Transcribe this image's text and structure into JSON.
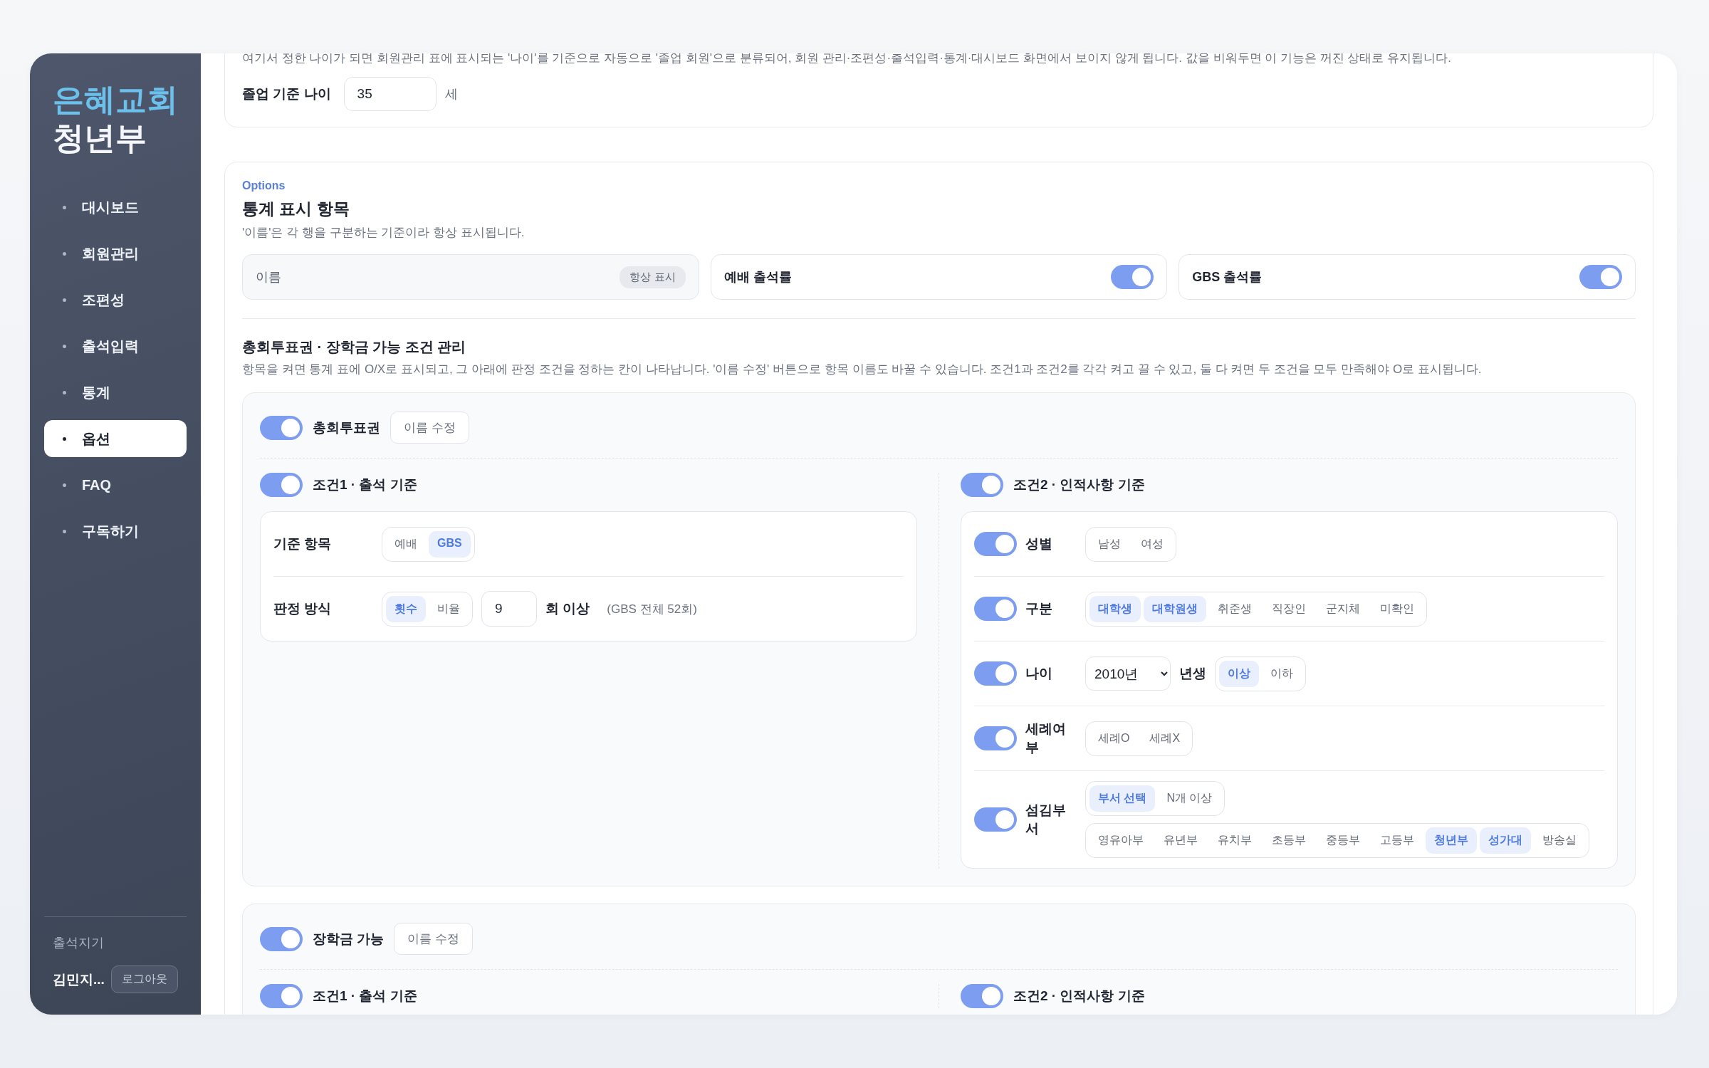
{
  "sidebar": {
    "logo_line1": "은혜교회",
    "logo_line2": "청년부",
    "items": [
      {
        "label": "대시보드",
        "selected": false
      },
      {
        "label": "회원관리",
        "selected": false
      },
      {
        "label": "조편성",
        "selected": false
      },
      {
        "label": "출석입력",
        "selected": false
      },
      {
        "label": "통계",
        "selected": false
      },
      {
        "label": "옵션",
        "selected": true
      },
      {
        "label": "FAQ",
        "selected": false
      },
      {
        "label": "구독하기",
        "selected": false
      }
    ],
    "footer_label": "출석지기",
    "user_name": "김민지...",
    "logout_button": "로그아웃"
  },
  "graduation": {
    "description": "여기서 정한 나이가 되면 회원관리 표에 표시되는 '나이'를 기준으로 자동으로 '졸업 회원'으로 분류되어, 회원 관리·조편성·출석입력·통계·대시보드 화면에서 보이지 않게 됩니다. 값을 비워두면 이 기능은 꺼진 상태로 유지됩니다.",
    "label": "졸업 기준 나이",
    "value": "35",
    "unit": "세"
  },
  "stats_options": {
    "eyebrow": "Options",
    "title": "통계 표시 항목",
    "description": "'이름'은 각 행을 구분하는 기준이라 항상 표시됩니다.",
    "items": [
      {
        "label": "이름",
        "kind": "fixed",
        "badge": "항상 표시"
      },
      {
        "label": "예배 출석률",
        "kind": "toggle",
        "on": true
      },
      {
        "label": "GBS 출석률",
        "kind": "toggle",
        "on": true
      }
    ]
  },
  "conditions": {
    "title": "총회투표권 · 장학금 가능 조건 관리",
    "description": "항목을 켜면 통계 표에 O/X로 표시되고, 그 아래에 판정 조건을 정하는 칸이 나타납니다. '이름 수정' 버튼으로 항목 이름도 바꿀 수 있습니다. 조건1과 조건2를 각각 켜고 끌 수 있고, 둘 다 켜면 두 조건을 모두 만족해야 O로 표시됩니다.",
    "panels": [
      {
        "name": "총회투표권",
        "on": true,
        "rename_button": "이름 수정",
        "condition1": {
          "title": "조건1 · 출석 기준",
          "on": true,
          "rows": [
            {
              "label": "기준 항목",
              "kind": "chips",
              "options": [
                {
                  "label": "예배",
                  "selected": false
                },
                {
                  "label": "GBS",
                  "selected": true
                }
              ]
            },
            {
              "label": "판정 방식",
              "kind": "count",
              "options": [
                {
                  "label": "횟수",
                  "selected": true
                },
                {
                  "label": "비율",
                  "selected": false
                }
              ],
              "value": "9",
              "suffix": "회 이상",
              "note": "(GBS 전체 52회)"
            }
          ]
        },
        "condition2": {
          "title": "조건2 · 인적사항 기준",
          "on": true,
          "rows": [
            {
              "label": "성별",
              "kind": "chips",
              "on": true,
              "options": [
                {
                  "label": "남성",
                  "selected": false
                },
                {
                  "label": "여성",
                  "selected": false
                }
              ]
            },
            {
              "label": "구분",
              "kind": "chips",
              "on": true,
              "options": [
                {
                  "label": "대학생",
                  "selected": true
                },
                {
                  "label": "대학원생",
                  "selected": true
                },
                {
                  "label": "취준생",
                  "selected": false
                },
                {
                  "label": "직장인",
                  "selected": false
                },
                {
                  "label": "군지체",
                  "selected": false
                },
                {
                  "label": "미확인",
                  "selected": false
                }
              ]
            },
            {
              "label": "나이",
              "kind": "year",
              "on": true,
              "select": "2010년",
              "suffix": "년생",
              "options": [
                {
                  "label": "이상",
                  "selected": true
                },
                {
                  "label": "이하",
                  "selected": false
                }
              ]
            },
            {
              "label": "세례여부",
              "kind": "chips",
              "on": true,
              "options": [
                {
                  "label": "세례O",
                  "selected": false
                },
                {
                  "label": "세례X",
                  "selected": false
                }
              ]
            },
            {
              "label": "섬김부서",
              "kind": "dept",
              "on": true,
              "modes": [
                {
                  "label": "부서 선택",
                  "selected": true
                },
                {
                  "label": "N개 이상",
                  "selected": false
                }
              ],
              "options": [
                {
                  "label": "영유아부",
                  "selected": false
                },
                {
                  "label": "유년부",
                  "selected": false
                },
                {
                  "label": "유치부",
                  "selected": false
                },
                {
                  "label": "초등부",
                  "selected": false
                },
                {
                  "label": "중등부",
                  "selected": false
                },
                {
                  "label": "고등부",
                  "selected": false
                },
                {
                  "label": "청년부",
                  "selected": true
                },
                {
                  "label": "성가대",
                  "selected": true
                },
                {
                  "label": "방송실",
                  "selected": false
                }
              ]
            }
          ]
        }
      },
      {
        "name": "장학금 가능",
        "on": true,
        "rename_button": "이름 수정",
        "condition1": {
          "title": "조건1 · 출석 기준",
          "on": true
        },
        "condition2": {
          "title": "조건2 · 인적사항 기준",
          "on": true
        }
      }
    ]
  }
}
